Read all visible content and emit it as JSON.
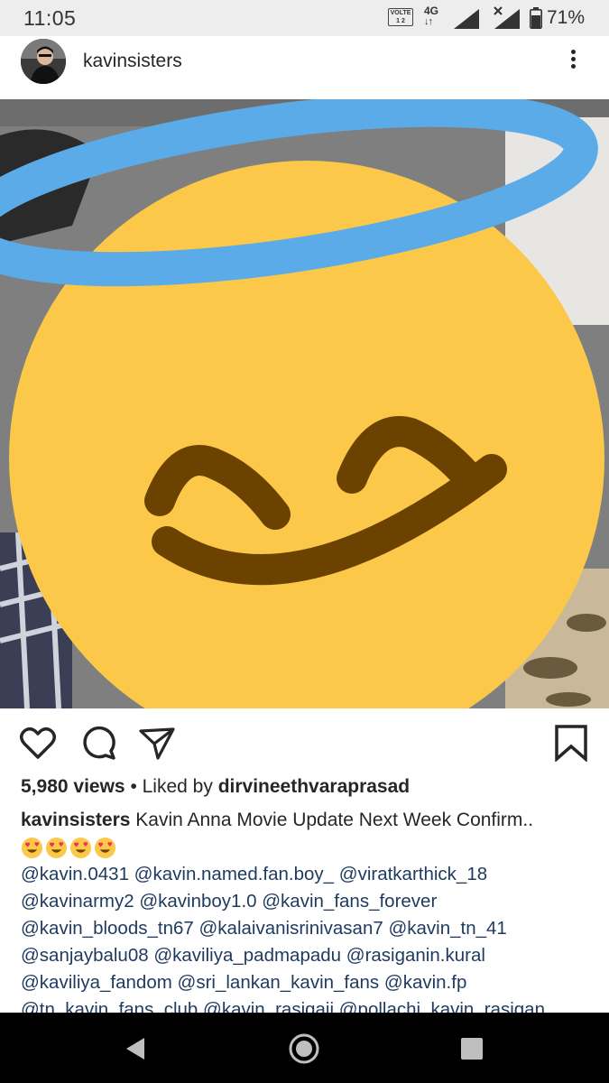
{
  "status_bar": {
    "time": "11:05",
    "network_badge_top": "VOLTE",
    "network_badge_bottom": "1 2",
    "network_type": "4G",
    "battery_percent": "71%"
  },
  "post": {
    "username": "kavinsisters",
    "views": "5,980 views",
    "liked_by_prefix": "Liked by",
    "liked_by_user": "dirvineethvaraprasad",
    "caption_user": "kavinsisters",
    "caption_text": "Kavin Anna  Movie Update Next Week Confirm..",
    "caption_emoji_count": 4,
    "tags_lines": [
      [
        "@kavin.0431",
        "@kavin.named.fan.boy_",
        "@viratkarthick_18"
      ],
      [
        "@kavinarmy2",
        "@kavinboy1.0",
        "@kavin_fans_forever"
      ],
      [
        "@kavin_bloods_tn67",
        "@kalaivanisrinivasan7",
        "@kavin_tn_41"
      ],
      [
        "@sanjaybalu08",
        "@kaviliya_padmapadu",
        "@rasiganin.kural"
      ],
      [
        "@kaviliya_fandom",
        "@sri_lankan_kavin_fans",
        "@kavin.fp"
      ],
      [
        "@tn_kavin_fans_club",
        "@kavin_rasigaii",
        "@pollachi_kavin_rasigan"
      ]
    ]
  },
  "icons": {
    "like": "heart-outline-icon",
    "comment": "comment-bubble-icon",
    "share": "paper-plane-icon",
    "save": "bookmark-icon",
    "more": "vertical-dots-icon",
    "overlay": "smiling-face-with-halo-emoji"
  },
  "colors": {
    "emoji_yellow": "#fcc84a",
    "halo_blue": "#5aabe8",
    "emoji_features": "#6b4200",
    "link_blue": "#1e3a5f"
  }
}
